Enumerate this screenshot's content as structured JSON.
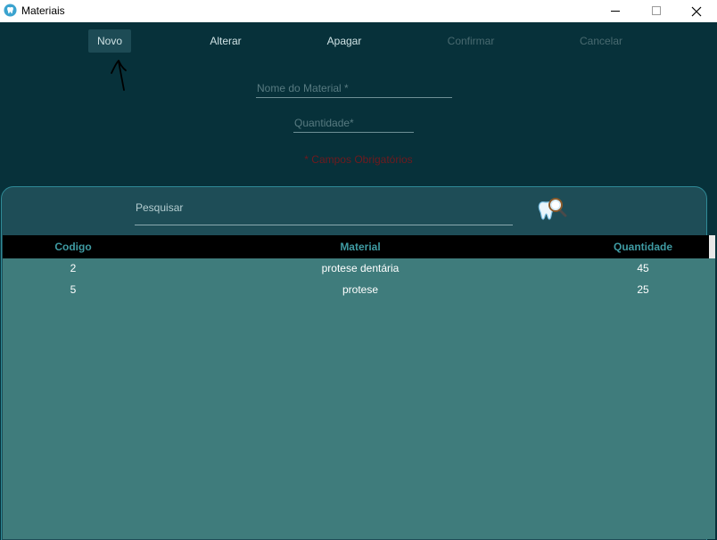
{
  "window": {
    "title": "Materiais"
  },
  "toolbar": {
    "novo": "Novo",
    "alterar": "Alterar",
    "apagar": "Apagar",
    "confirmar": "Confirmar",
    "cancelar": "Cancelar"
  },
  "form": {
    "nome_placeholder": "Nome do Material *",
    "quantidade_placeholder": "Quantidade*",
    "required_note": "* Campos Obrigatórios"
  },
  "search": {
    "placeholder": "Pesquisar",
    "icon": "tooth-magnifier-icon"
  },
  "table": {
    "columns": [
      "Codigo",
      "Material",
      "Quantidade"
    ],
    "rows": [
      {
        "codigo": "2",
        "material": "protese dentária",
        "quantidade": "45"
      },
      {
        "codigo": "5",
        "material": "protese",
        "quantidade": "25"
      }
    ]
  },
  "colors": {
    "background": "#07313a",
    "panel": "#1e4d57",
    "table_body": "#3f7c7c",
    "header_text": "#3f9ba3",
    "required_note": "#6f1a1e"
  }
}
